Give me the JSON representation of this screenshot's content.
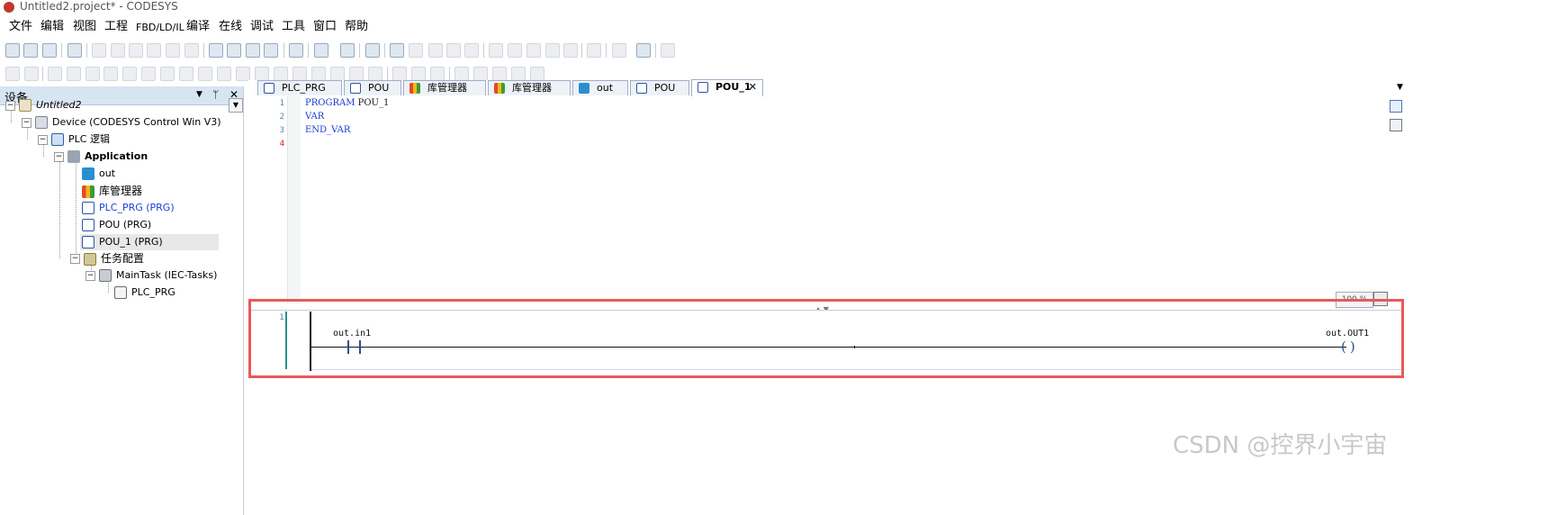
{
  "window": {
    "title": "Untitled2.project* - CODESYS"
  },
  "menu": [
    "文件",
    "编辑",
    "视图",
    "工程",
    "FBD/LD/IL",
    "编译",
    "在线",
    "调试",
    "工具",
    "窗口",
    "帮助"
  ],
  "device_pane": {
    "title": "设备",
    "controls": [
      "▼",
      "ᛘ",
      "✕"
    ],
    "tree": [
      {
        "label": "Untitled2",
        "icon": "project-icon",
        "style": "italic"
      },
      {
        "label": "Device (CODESYS Control Win V3)",
        "icon": "device-icon"
      },
      {
        "label": "PLC 逻辑",
        "icon": "plc-logic-icon"
      },
      {
        "label": "Application",
        "icon": "application-gear-icon",
        "style": "bold"
      },
      {
        "label": "out",
        "icon": "globe-icon"
      },
      {
        "label": "库管理器",
        "icon": "library-manager-icon"
      },
      {
        "label": "PLC_PRG (PRG)",
        "icon": "st-document-icon",
        "style": "blue"
      },
      {
        "label": "POU (PRG)",
        "icon": "fbd-document-icon"
      },
      {
        "label": "POU_1 (PRG)",
        "icon": "fbd-document-icon",
        "selected": true
      },
      {
        "label": "任务配置",
        "icon": "task-config-icon"
      },
      {
        "label": "MainTask (IEC-Tasks)",
        "icon": "task-stack-icon"
      },
      {
        "label": "PLC_PRG",
        "icon": "program-call-icon"
      }
    ]
  },
  "tabs": [
    {
      "label": "PLC_PRG",
      "icon": "st-document-icon"
    },
    {
      "label": "POU",
      "icon": "fbd-document-icon"
    },
    {
      "label": "库管理器",
      "icon": "library-manager-icon"
    },
    {
      "label": "库管理器",
      "icon": "library-manager-icon"
    },
    {
      "label": "out",
      "icon": "globe-icon"
    },
    {
      "label": "POU",
      "icon": "fbd-document-icon"
    },
    {
      "label": "POU_1",
      "icon": "fbd-document-icon",
      "active": true,
      "close": "✕"
    }
  ],
  "declaration": {
    "line_numbers": [
      "1",
      "2",
      "3",
      "4"
    ],
    "lines": [
      {
        "keyword": "PROGRAM",
        "text": " POU_1"
      },
      {
        "keyword": "VAR",
        "text": ""
      },
      {
        "keyword": "END_VAR",
        "text": ""
      },
      {
        "keyword": "",
        "text": ""
      }
    ]
  },
  "zoom": "100 %",
  "ladder": {
    "network_number": "1",
    "contact_variable": "out.in1",
    "coil_variable": "out.OUT1"
  },
  "watermark": "CSDN @控界小宇宙",
  "colors": {
    "highlight_border": "#e9595b",
    "keyword_blue": "#1b3bd4",
    "pane_header": "#d7e4f2"
  }
}
